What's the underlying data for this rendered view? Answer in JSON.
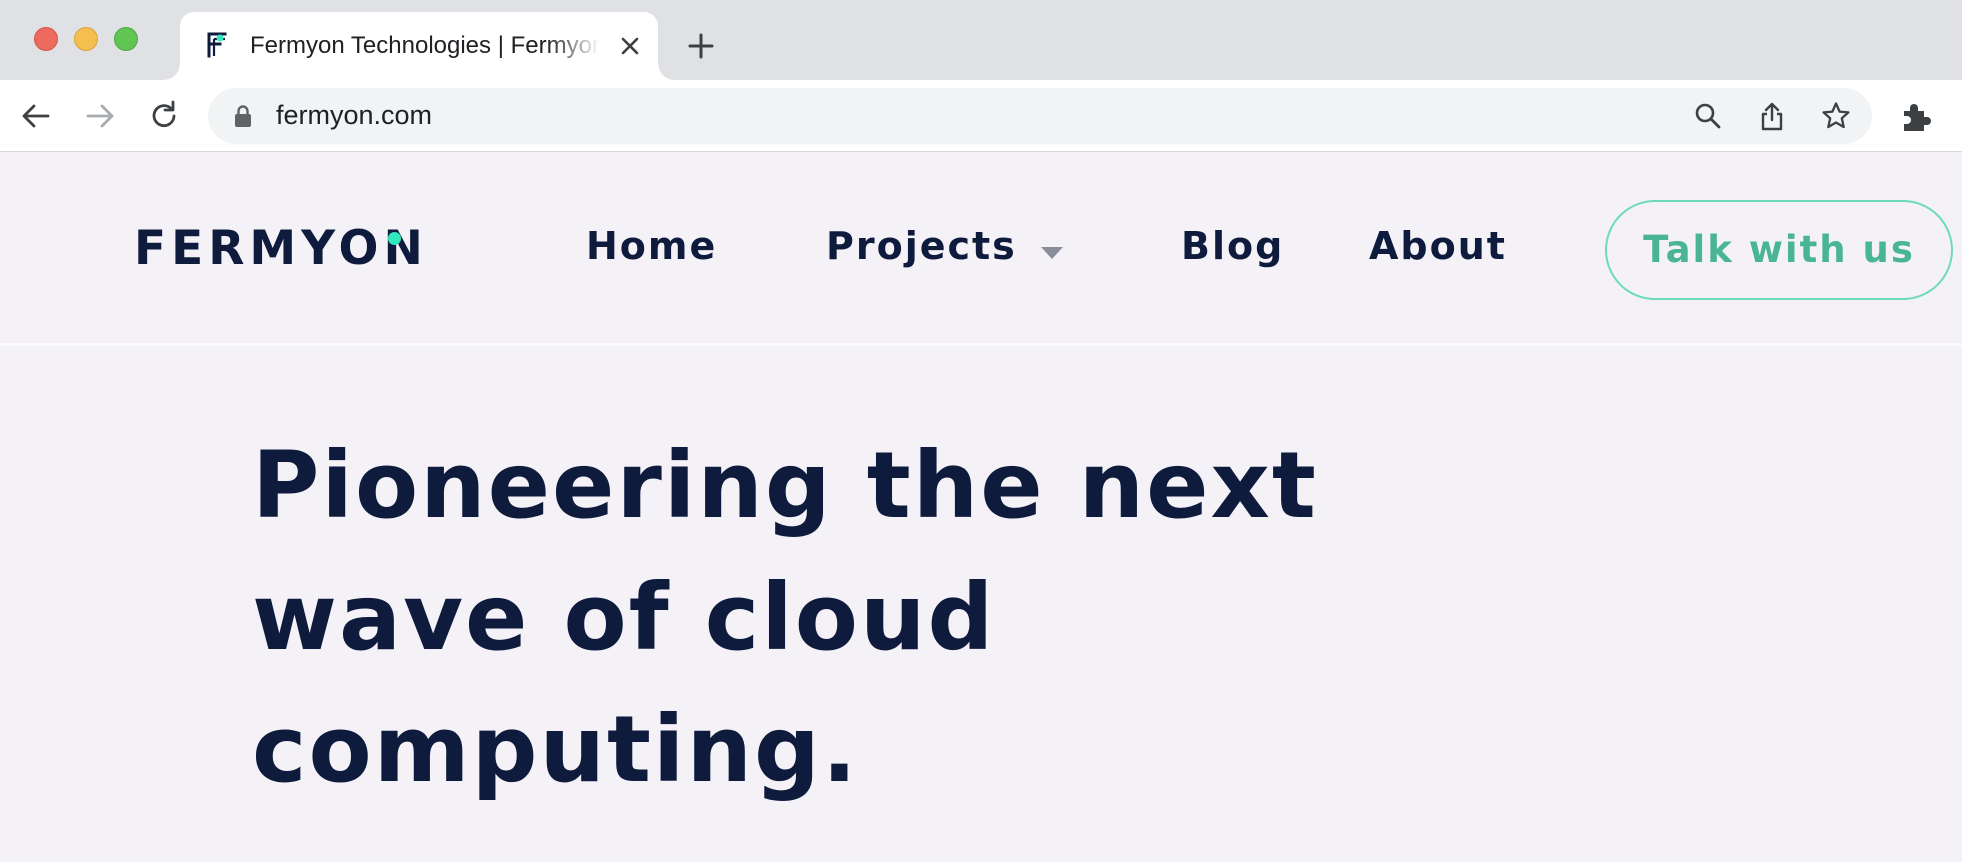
{
  "browser": {
    "tab_title": "Fermyon Technologies | Fermyon",
    "url": "fermyon.com"
  },
  "header": {
    "logo_text": "FERMYON",
    "nav": [
      {
        "label": "Home"
      },
      {
        "label": "Projects"
      },
      {
        "label": "Blog"
      },
      {
        "label": "About"
      }
    ],
    "cta_label": "Talk with us"
  },
  "hero": {
    "lines": [
      "Pioneering the next",
      "wave of cloud",
      "computing."
    ]
  },
  "colors": {
    "navy": "#0e1b3d",
    "accent_teal": "#34e8bd",
    "cta_green": "#49b592",
    "page_bg": "#f4f2f7"
  }
}
